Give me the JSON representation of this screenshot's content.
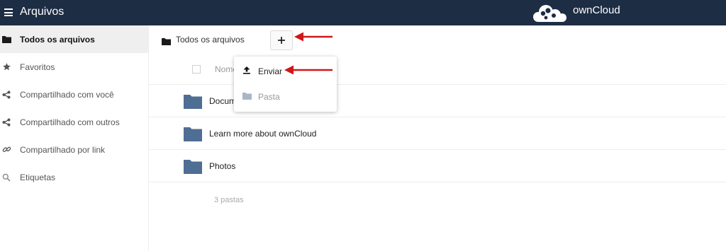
{
  "header": {
    "app_title": "Arquivos",
    "brand_name": "ownCloud",
    "menu_icon": "hamburger-menu-icon",
    "logo_icon": "cloud-logo-icon"
  },
  "sidebar": {
    "items": [
      {
        "label": "Todos os arquivos",
        "icon": "folder-icon",
        "active": true
      },
      {
        "label": "Favoritos",
        "icon": "star-icon",
        "active": false
      },
      {
        "label": "Compartilhado com você",
        "icon": "share-icon",
        "active": false
      },
      {
        "label": "Compartilhado com outros",
        "icon": "share-icon",
        "active": false
      },
      {
        "label": "Compartilhado por link",
        "icon": "link-icon",
        "active": false
      },
      {
        "label": "Etiquetas",
        "icon": "search-icon",
        "active": false
      }
    ]
  },
  "breadcrumb": {
    "label": "Todos os arquivos",
    "add_label": "+"
  },
  "file_list": {
    "column_name": "Nome",
    "rows": [
      {
        "name": "Documents",
        "icon": "folder-icon"
      },
      {
        "name": "Learn more about ownCloud",
        "icon": "folder-icon"
      },
      {
        "name": "Photos",
        "icon": "folder-icon"
      }
    ],
    "summary": "3 pastas"
  },
  "new_menu": {
    "items": [
      {
        "label": "Enviar",
        "icon": "upload-icon",
        "enabled": true
      },
      {
        "label": "Pasta",
        "icon": "folder-icon",
        "enabled": false
      }
    ]
  },
  "colors": {
    "header_bg": "#1d2d44",
    "folder": "#4e6e94",
    "folder_disabled": "#a9b6c6",
    "annotation_arrow": "#d0171a"
  }
}
